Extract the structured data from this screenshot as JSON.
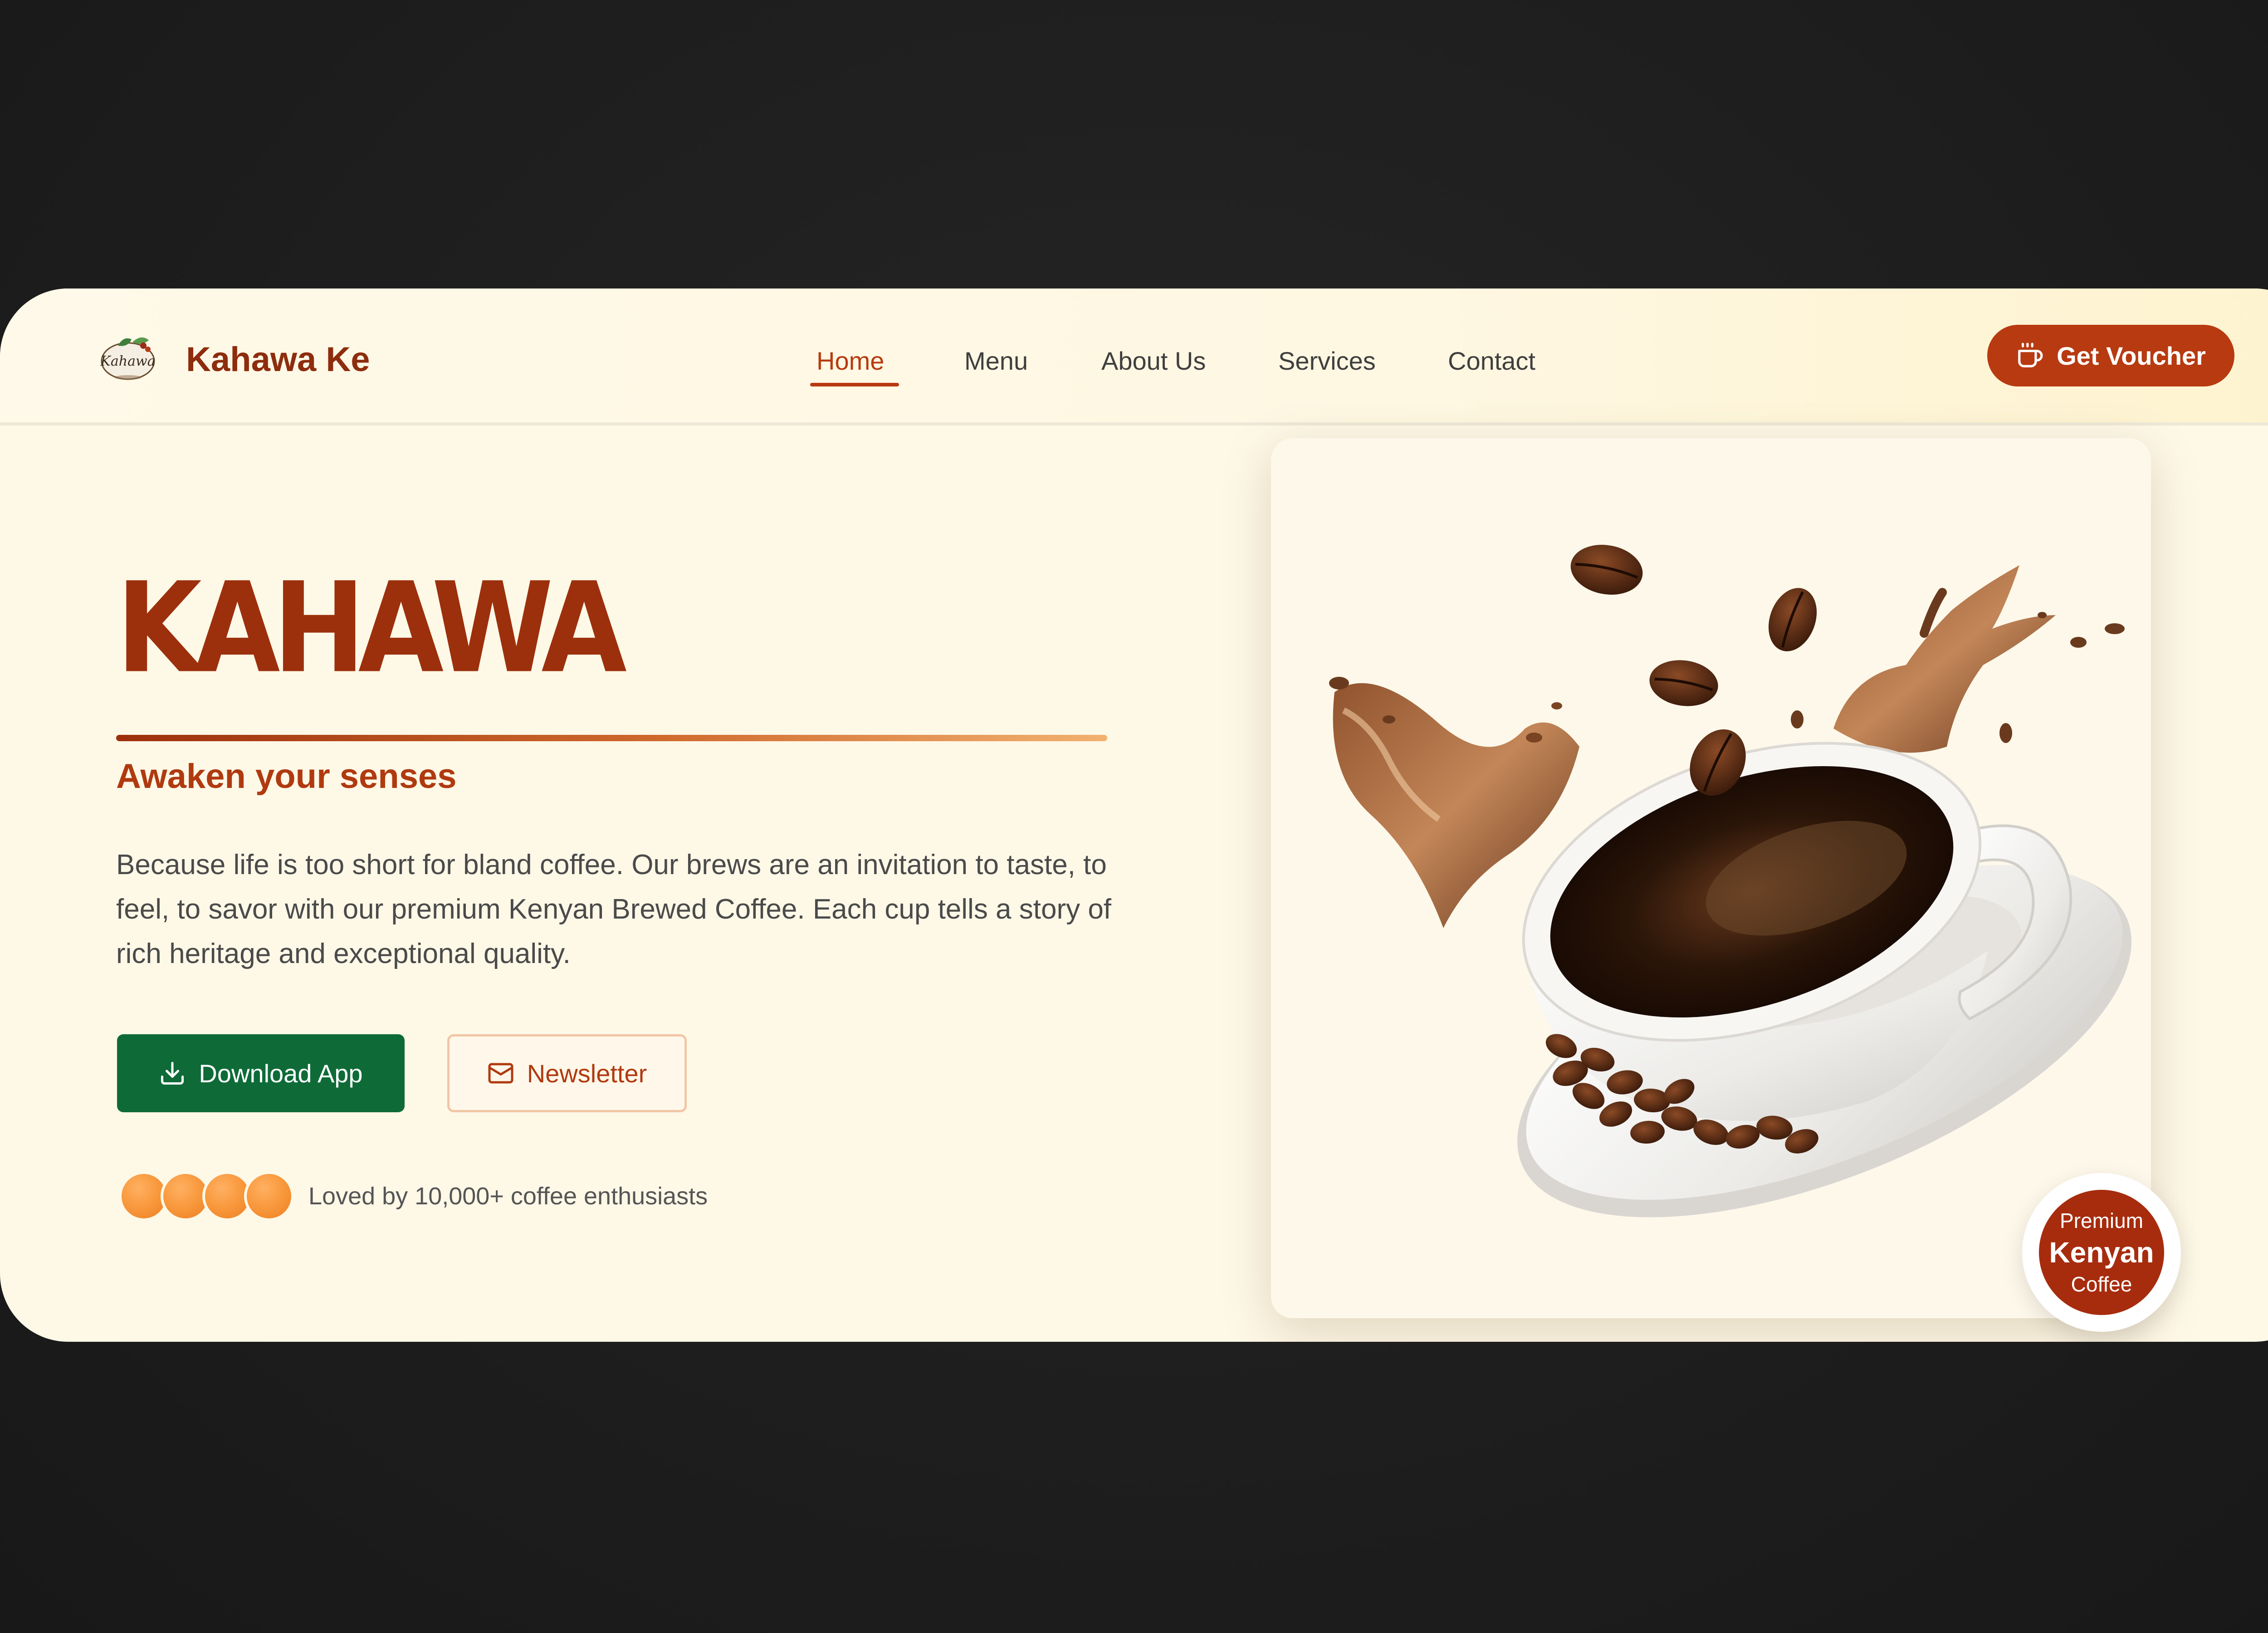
{
  "brand": {
    "name": "Kahawa Ke",
    "logo_text": "Kahawa",
    "logo_icon": "coffee-leaf-logo"
  },
  "nav": {
    "links": [
      "Home",
      "Menu",
      "About Us",
      "Services",
      "Contact"
    ],
    "active": "Home"
  },
  "voucher": {
    "label": "Get Voucher",
    "icon": "coffee-cup-icon"
  },
  "hero": {
    "title": "KAHAWA",
    "tagline": "Awaken your senses",
    "description": "Because life is too short for bland coffee. Our brews are an invitation to taste, to feel, to savor with our premium Kenyan Brewed Coffee. Each cup tells a story of rich heritage and exceptional quality.",
    "download_label": "Download App",
    "download_icon": "download-icon",
    "newsletter_label": "Newsletter",
    "newsletter_icon": "mail-icon",
    "social_proof": "Loved by 10,000+ coffee enthusiasts",
    "avatar_count": 4
  },
  "badge": {
    "line1": "Premium",
    "line2": "Kenyan",
    "line3": "Coffee"
  },
  "colors": {
    "brand_brown": "#8d2d0d",
    "accent_rust": "#b83a10",
    "cta_green": "#0e6b38",
    "cream": "#fef8e7",
    "avatar_orange": "#f99a3f"
  }
}
